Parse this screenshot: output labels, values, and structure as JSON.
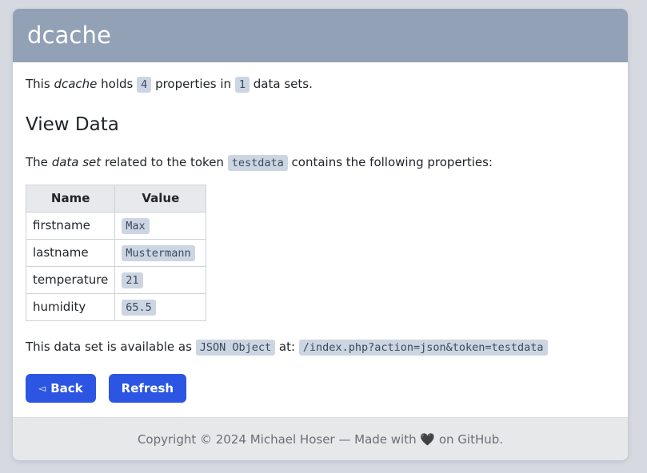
{
  "app": {
    "title": "dcache",
    "header_bg": "#93a1b6",
    "accent": "#2b55e2",
    "page_bg": "#d6d9e0"
  },
  "summary": {
    "prefix": "This",
    "name_italic": "dcache",
    "mid1": "holds",
    "properties_count": "4",
    "mid2": "properties in",
    "datasets_count": "1",
    "suffix": "data sets."
  },
  "section": {
    "heading": "View Data",
    "desc_prefix": "The",
    "desc_italic": "data set",
    "desc_mid": "related to the token",
    "token": "testdata",
    "desc_suffix": "contains the following properties:"
  },
  "table": {
    "columns": [
      "Name",
      "Value"
    ],
    "rows": [
      {
        "name": "firstname",
        "value": "Max"
      },
      {
        "name": "lastname",
        "value": "Mustermann"
      },
      {
        "name": "temperature",
        "value": "21"
      },
      {
        "name": "humidity",
        "value": "65.5"
      }
    ]
  },
  "availability": {
    "prefix": "This data set is available as",
    "format_label": "JSON Object",
    "mid": "at:",
    "url": "/index.php?action=json&token=testdata"
  },
  "buttons": {
    "back_icon": "◅",
    "back_label": "Back",
    "refresh_label": "Refresh"
  },
  "footer": {
    "text_before": "Copyright © 2024 Michael Hoser — Made with",
    "heart": "🖤",
    "text_after": "on GitHub."
  }
}
